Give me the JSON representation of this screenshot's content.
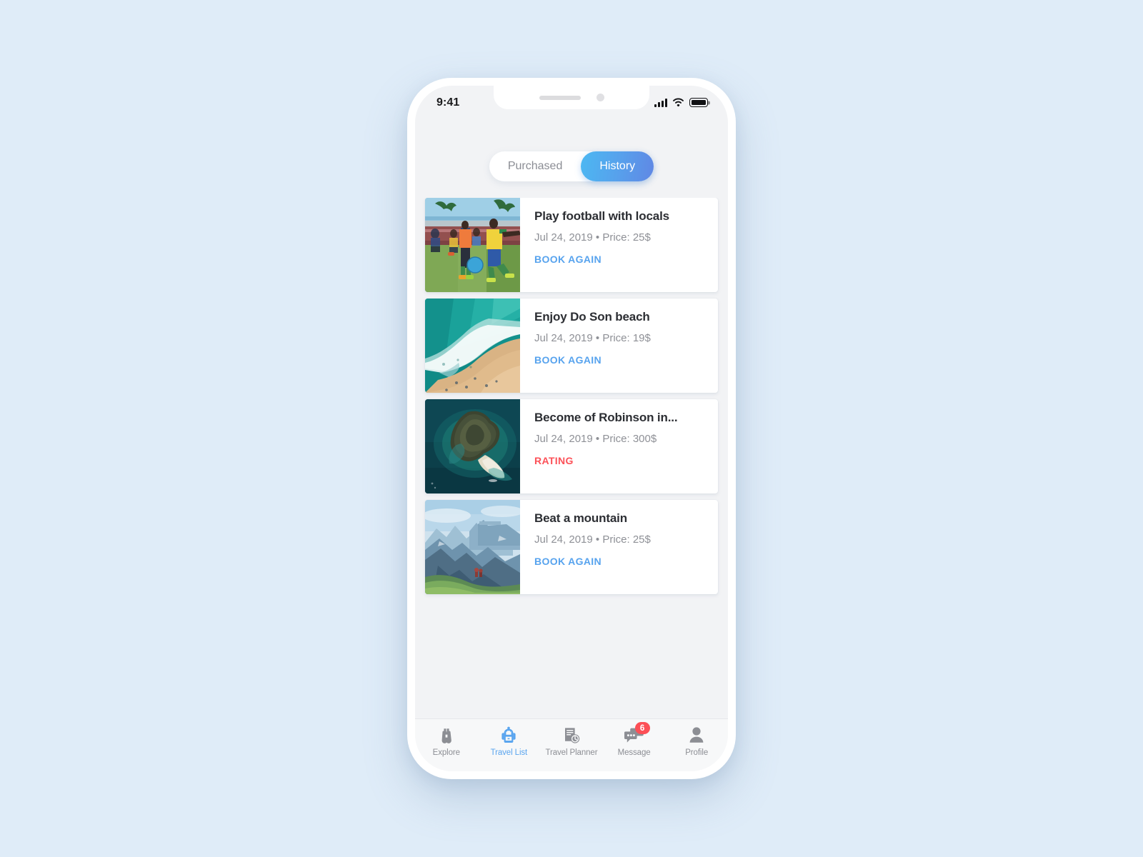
{
  "status_bar": {
    "time": "9:41",
    "signal_icon": "cellular-signal-icon",
    "wifi_icon": "wifi-icon",
    "battery_icon": "battery-full-icon"
  },
  "segmented_control": {
    "tabs": [
      {
        "label": "Purchased",
        "active": false
      },
      {
        "label": "History",
        "active": true
      }
    ],
    "active_gradient_from": "#4cb8f2",
    "active_gradient_to": "#6087e4"
  },
  "cards": [
    {
      "title": "Play football with locals",
      "meta": "Jul 24, 2019 • Price: 25$",
      "action": "BOOK AGAIN",
      "action_type": "book",
      "action_color": "#57a3ee",
      "image": "football-players-on-pitch"
    },
    {
      "title": "Enjoy Do Son beach",
      "meta": "Jul 24, 2019 • Price: 19$",
      "action": "BOOK AGAIN",
      "action_type": "book",
      "action_color": "#57a3ee",
      "image": "aerial-beach-waves"
    },
    {
      "title": "Become of Robinson in...",
      "meta": "Jul 24, 2019 • Price: 300$",
      "action": "RATING",
      "action_type": "rating",
      "action_color": "#fc5158",
      "image": "aerial-tropical-island"
    },
    {
      "title": "Beat a mountain",
      "meta": "Jul 24, 2019 • Price: 25$",
      "action": "BOOK AGAIN",
      "action_type": "book",
      "action_color": "#57a3ee",
      "image": "mountain-range-meadow"
    }
  ],
  "tab_bar": {
    "items": [
      {
        "label": "Explore",
        "icon": "binoculars-icon",
        "active": false,
        "badge": null
      },
      {
        "label": "Travel List",
        "icon": "backpack-icon",
        "active": true,
        "badge": null
      },
      {
        "label": "Travel Planner",
        "icon": "document-clock-icon",
        "active": false,
        "badge": null
      },
      {
        "label": "Message",
        "icon": "chat-bubbles-icon",
        "active": false,
        "badge": "6"
      },
      {
        "label": "Profile",
        "icon": "person-icon",
        "active": false,
        "badge": null
      }
    ],
    "active_color": "#5aa5ef",
    "inactive_color": "#8c8e94",
    "badge_color": "#fc4f56"
  }
}
